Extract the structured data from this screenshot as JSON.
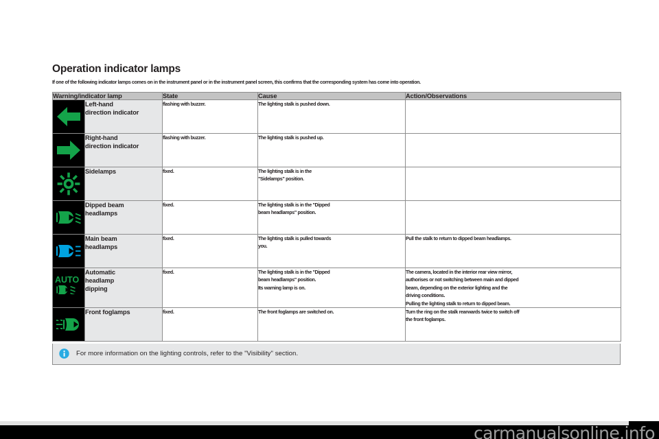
{
  "document": {
    "section_title": "Operation indicator lamps",
    "section_intro": "If one of the following indicator lamps comes on in the instrument panel or in the instrument panel screen, this confirms that the corresponding system has come into operation."
  },
  "table": {
    "headers": {
      "lamp": "Warning/indicator lamp",
      "state": "State",
      "cause": "Cause",
      "action": "Action/Observations"
    },
    "rows": [
      {
        "icon": "left-arrow-icon",
        "icon_color": "#14a34a",
        "lamp": "Left-hand\ndirection indicator",
        "state": [
          "flashing with buzzer."
        ],
        "cause": [
          "The lighting stalk is pushed down."
        ],
        "action": []
      },
      {
        "icon": "right-arrow-icon",
        "icon_color": "#14a34a",
        "lamp": "Right-hand\ndirection indicator",
        "state": [
          "flashing with buzzer."
        ],
        "cause": [
          "The lighting stalk is pushed up."
        ],
        "action": []
      },
      {
        "icon": "sidelamps-icon",
        "icon_color": "#14a34a",
        "lamp": "Sidelamps",
        "state": [
          "fixed."
        ],
        "cause": [
          "The lighting stalk is in the",
          "\"Sidelamps\" position."
        ],
        "action": []
      },
      {
        "icon": "dipped-beam-icon",
        "icon_color": "#14a34a",
        "lamp": "Dipped beam\nheadlamps",
        "state": [
          "fixed."
        ],
        "cause": [
          "The lighting stalk is in the \"Dipped",
          "beam headlamps\" position."
        ],
        "action": []
      },
      {
        "icon": "main-beam-icon",
        "icon_color": "#00a3e0",
        "lamp": "Main beam\nheadlamps",
        "state": [
          "fixed."
        ],
        "cause": [
          "The lighting stalk is pulled towards",
          "you."
        ],
        "action": [
          "Pull the stalk to return to dipped beam headlamps."
        ]
      },
      {
        "icon": "auto-headlamp-dipping-icon",
        "icon_color": "#14a34a",
        "lamp": "Automatic\nheadlamp\ndipping",
        "state": [
          "fixed."
        ],
        "cause": [
          "The lighting stalk is in the \"Dipped",
          "beam headlamps\" position.",
          "Its warning lamp is on."
        ],
        "action": [
          "The camera, located in the interior rear view mirror,",
          "authorises or not switching between main and dipped",
          "beam, depending on the exterior lighting and the",
          "driving conditions.",
          "Pulling the lighting stalk to return to dipped beam."
        ]
      },
      {
        "icon": "front-foglamps-icon",
        "icon_color": "#14a34a",
        "lamp": "Front foglamps",
        "state": [
          "fixed."
        ],
        "cause": [
          "The front foglamps are switched on."
        ],
        "action": [
          "Turn the ring on the stalk rearwards twice to switch off",
          "the front foglamps."
        ]
      }
    ]
  },
  "note": {
    "icon": "info-icon",
    "icon_color": "#29abe2",
    "text": "For more information on the lighting controls, refer to the \"Visibility\" section."
  },
  "watermark": {
    "text": "carmanualsonline.info"
  }
}
